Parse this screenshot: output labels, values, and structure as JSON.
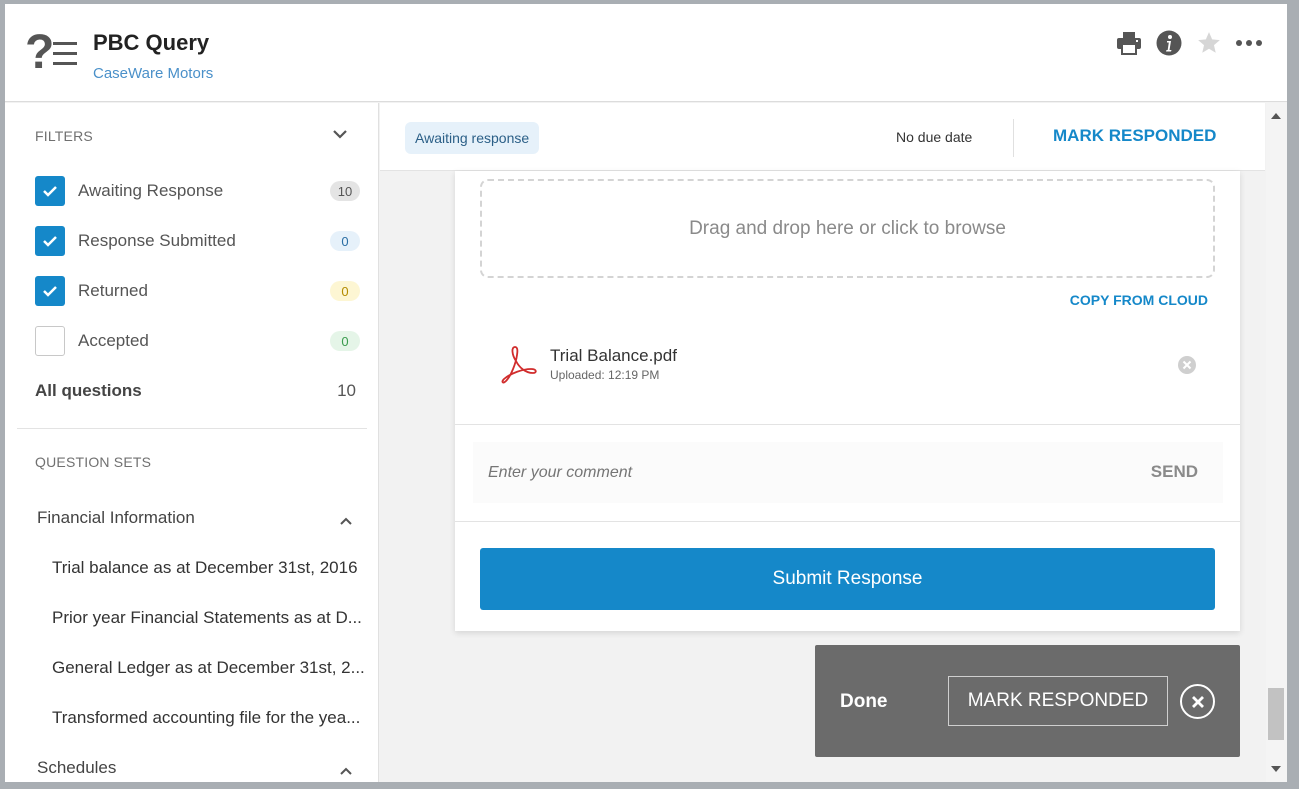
{
  "header": {
    "title": "PBC Query",
    "subtitle": "CaseWare Motors",
    "icons": [
      "print-icon",
      "info-icon",
      "star-icon",
      "more-icon"
    ]
  },
  "sidebar": {
    "filters_heading": "FILTERS",
    "filters": [
      {
        "label": "Awaiting Response",
        "count": "10",
        "checked": true,
        "badge_bg": "#e4e4e4",
        "badge_color": "#555555"
      },
      {
        "label": "Response Submitted",
        "count": "0",
        "checked": true,
        "badge_bg": "#e6f1fa",
        "badge_color": "#2b6ea3"
      },
      {
        "label": "Returned",
        "count": "0",
        "checked": true,
        "badge_bg": "#fdf6d3",
        "badge_color": "#b38b00"
      },
      {
        "label": "Accepted",
        "count": "0",
        "checked": false,
        "badge_bg": "#e5f5e8",
        "badge_color": "#3a9b4d"
      }
    ],
    "all_questions_label": "All questions",
    "all_questions_count": "10",
    "question_sets_heading": "QUESTION SETS",
    "question_sets": [
      {
        "name": "Financial Information",
        "items": [
          "Trial balance as at December 31st, 2016",
          "Prior year Financial Statements as at D...",
          "General Ledger as at December 31st, 2...",
          "Transformed accounting file for the yea..."
        ]
      },
      {
        "name": "Schedules",
        "items": []
      }
    ]
  },
  "main": {
    "status": "Awaiting response",
    "due_date": "No due date",
    "mark_responded": "MARK RESPONDED",
    "dropzone_text": "Drag and drop here or click to browse",
    "copy_from_cloud": "COPY FROM CLOUD",
    "file": {
      "name": "Trial Balance.pdf",
      "meta": "Uploaded: 12:19 PM"
    },
    "comment_placeholder": "Enter your comment",
    "send_label": "SEND",
    "submit_label": "Submit Response"
  },
  "toast": {
    "title": "Done",
    "button": "MARK RESPONDED"
  },
  "colors": {
    "accent": "#1588c9",
    "link": "#4a90c9",
    "toast_bg": "#6b6b6b"
  }
}
